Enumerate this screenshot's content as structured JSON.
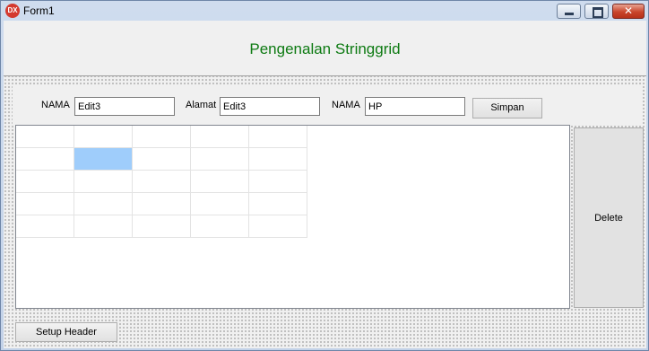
{
  "window": {
    "icon_text": "DX",
    "title": "Form1",
    "close_glyph": "✕"
  },
  "header": {
    "title": "Pengenalan Stringgrid",
    "title_color": "#0d7a12"
  },
  "form": {
    "nama_label": "NAMA",
    "nama_value": "Edit3",
    "alamat_label": "Alamat",
    "alamat_value": "Edit3",
    "nama2_label": "NAMA",
    "nama2_value": "HP",
    "simpan_label": "Simpan"
  },
  "grid": {
    "rows": 5,
    "cols": 5,
    "selected_row": 1,
    "selected_col": 1,
    "selected_color": "#9fcdfb"
  },
  "buttons": {
    "delete_label": "Delete",
    "setup_header_label": "Setup Header"
  }
}
